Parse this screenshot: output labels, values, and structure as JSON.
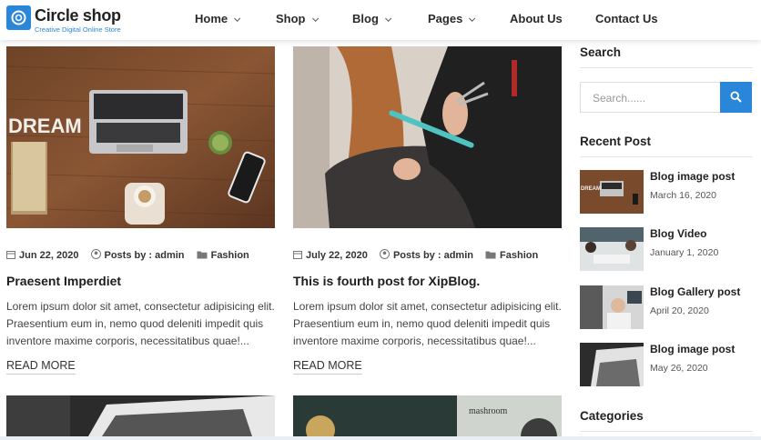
{
  "logo": {
    "title": "Circle shop",
    "subtitle": "Creative Digital Online Store"
  },
  "nav": {
    "items": [
      {
        "label": "Home",
        "has_dropdown": true
      },
      {
        "label": "Shop",
        "has_dropdown": true
      },
      {
        "label": "Blog",
        "has_dropdown": true
      },
      {
        "label": "Pages",
        "has_dropdown": true
      },
      {
        "label": "About Us",
        "has_dropdown": false
      },
      {
        "label": "Contact Us",
        "has_dropdown": false
      }
    ]
  },
  "posts": [
    {
      "date": "Jun 22, 2020",
      "author": "Posts by : admin",
      "category": "Fashion",
      "title": "Praesent Imperdiet",
      "excerpt": "Lorem ipsum dolor sit amet, consectetur adipisicing elit. Praesentium eum in, nemo quod deleniti impedit quis inventore maxime corporis, necessitatibus quae!...",
      "read_more": "READ MORE"
    },
    {
      "date": "July 22, 2020",
      "author": "Posts by : admin",
      "category": "Fashion",
      "title": "This is fourth post for XipBlog.",
      "excerpt": "Lorem ipsum dolor sit amet, consectetur adipisicing elit. Praesentium eum in, nemo quod deleniti impedit quis inventore maxime corporis, necessitatibus quae!...",
      "read_more": "READ MORE"
    }
  ],
  "lower_image_text": "mashroom",
  "sidebar": {
    "search_title": "Search",
    "search_placeholder": "Search......",
    "recent_title": "Recent Post",
    "recent": [
      {
        "title": "Blog image post",
        "date": "March 16, 2020"
      },
      {
        "title": "Blog Video",
        "date": "January 1, 2020"
      },
      {
        "title": "Blog Gallery post",
        "date": "April 20, 2020"
      },
      {
        "title": "Blog image post",
        "date": "May 26, 2020"
      }
    ],
    "categories_title": "Categories"
  },
  "colors": {
    "accent": "#2a86d8"
  }
}
